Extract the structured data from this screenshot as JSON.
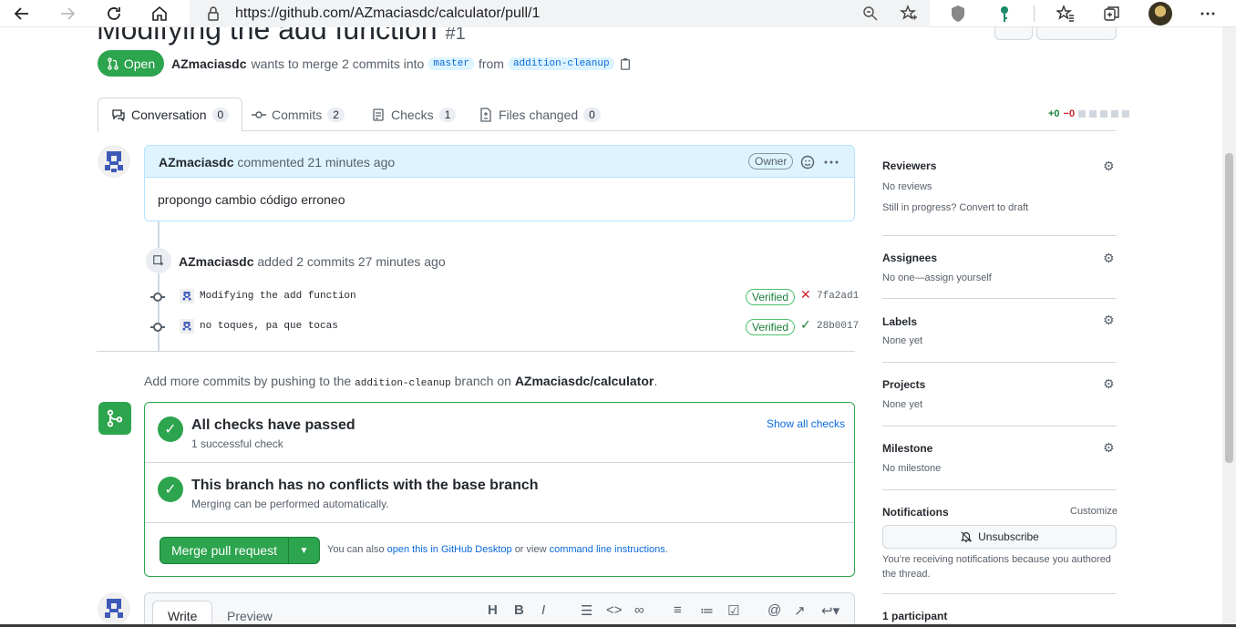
{
  "browser": {
    "url": "https://github.com/AZmaciasdc/calculator/pull/1",
    "icons": [
      "back-icon",
      "forward-icon",
      "refresh-icon",
      "home-icon",
      "lock-icon",
      "zoom-icon",
      "favorite-add-icon",
      "shield-extension-icon",
      "key-extension-icon",
      "favorites-icon",
      "collections-icon",
      "profile-avatar",
      "more-icon"
    ]
  },
  "pr": {
    "title": "Modifying the add function",
    "number": "#1",
    "state": "Open",
    "author": "AZmaciasdc",
    "merge_text": "wants to merge 2 commits into",
    "base_branch": "master",
    "from_text": "from",
    "head_branch": "addition-cleanup"
  },
  "tabs": [
    {
      "label": "Conversation",
      "count": "0"
    },
    {
      "label": "Commits",
      "count": "2"
    },
    {
      "label": "Checks",
      "count": "1"
    },
    {
      "label": "Files changed",
      "count": "0"
    }
  ],
  "diffstat": {
    "added": "+0",
    "removed": "−0"
  },
  "comment": {
    "author": "AZmaciasdc",
    "action": "commented",
    "time": "21 minutes ago",
    "badge": "Owner",
    "body": "propongo cambio código erroneo"
  },
  "push_event": {
    "author": "AZmaciasdc",
    "text": "added 2 commits",
    "time": "27 minutes ago"
  },
  "commits": [
    {
      "message": "Modifying the add function",
      "verified": "Verified",
      "status": "fail",
      "sha": "7fa2ad1"
    },
    {
      "message": "no toques, pa que tocas",
      "verified": "Verified",
      "status": "pass",
      "sha": "28b0017"
    }
  ],
  "hint": {
    "prefix": "Add more commits by pushing to the",
    "branch": "addition-cleanup",
    "middle": "branch on",
    "repo": "AZmaciasdc/calculator",
    "suffix": "."
  },
  "merge": {
    "checks_title": "All checks have passed",
    "checks_sub": "1 successful check",
    "show_all": "Show all checks",
    "conflicts_title": "This branch has no conflicts with the base branch",
    "conflicts_sub": "Merging can be performed automatically.",
    "button": "Merge pull request",
    "alt_prefix": "You can also",
    "alt_link1": "open this in GitHub Desktop",
    "alt_middle": "or view",
    "alt_link2": "command line instructions",
    "alt_suffix": "."
  },
  "editor": {
    "write": "Write",
    "preview": "Preview"
  },
  "sidebar": {
    "reviewers": {
      "title": "Reviewers",
      "value": "No reviews",
      "note": "Still in progress? Convert to draft"
    },
    "assignees": {
      "title": "Assignees",
      "value": "No one—assign yourself"
    },
    "labels": {
      "title": "Labels",
      "value": "None yet"
    },
    "projects": {
      "title": "Projects",
      "value": "None yet"
    },
    "milestone": {
      "title": "Milestone",
      "value": "No milestone"
    },
    "notifications": {
      "title": "Notifications",
      "customize": "Customize",
      "button": "Unsubscribe",
      "note1": "You’re receiving notifications because you authored",
      "note2": "the thread."
    },
    "participants": {
      "title": "1 participant"
    }
  }
}
